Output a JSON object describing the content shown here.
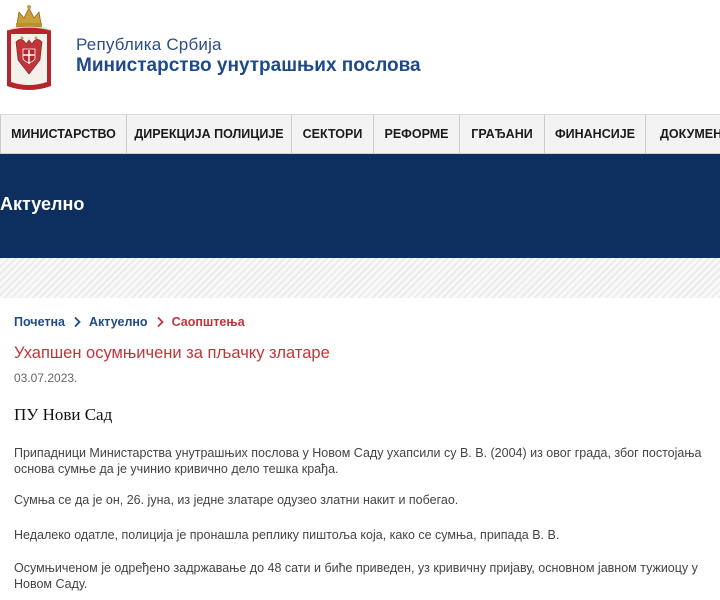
{
  "header": {
    "line1": "Република Србија",
    "line2": "Министарство унутрашњих послова"
  },
  "nav": {
    "items": [
      {
        "label": "МИНИСТАРСТВО"
      },
      {
        "label": "ДИРЕКЦИЈА ПОЛИЦИЈЕ"
      },
      {
        "label": "СЕКТОРИ"
      },
      {
        "label": "РЕФОРМЕ"
      },
      {
        "label": "ГРАЂАНИ"
      },
      {
        "label": "ФИНАНСИЈЕ"
      },
      {
        "label": "ДОКУМЕНТ"
      }
    ]
  },
  "banner": {
    "title": "Актуелно"
  },
  "breadcrumb": {
    "items": [
      "Почетна",
      "Актуелно",
      "Саопштења"
    ],
    "separator_icon": "chevron-right-icon"
  },
  "article": {
    "title": "Ухапшен осумњичени за пљачку златаре",
    "date": "03.07.2023.",
    "station": "ПУ Нови Сад",
    "paragraphs": [
      "Припадници Министарства унутрашњих послова у Новом Саду ухапсили су В. В. (2004) из овог града, због постојања основа сумње да је учинио кривично дело тешка крађа.",
      "Сумња се да је он, 26. јуна, из једне златаре одузео златни накит и побегао.",
      "Недалеко одатле, полиција је пронашла реплику пиштоља која, како се сумња, припада В. В.",
      "Осумњиченом је одређено задржавање до 48 сати и биће приведен, уз кривичну пријаву, основном јавном тужиоцу у Новом Саду."
    ]
  },
  "colors": {
    "brand_blue": "#1f4a8a",
    "banner_navy": "#0d2f5f",
    "accent_red": "#c0353a",
    "nav_bg": "#f3f3f3"
  }
}
